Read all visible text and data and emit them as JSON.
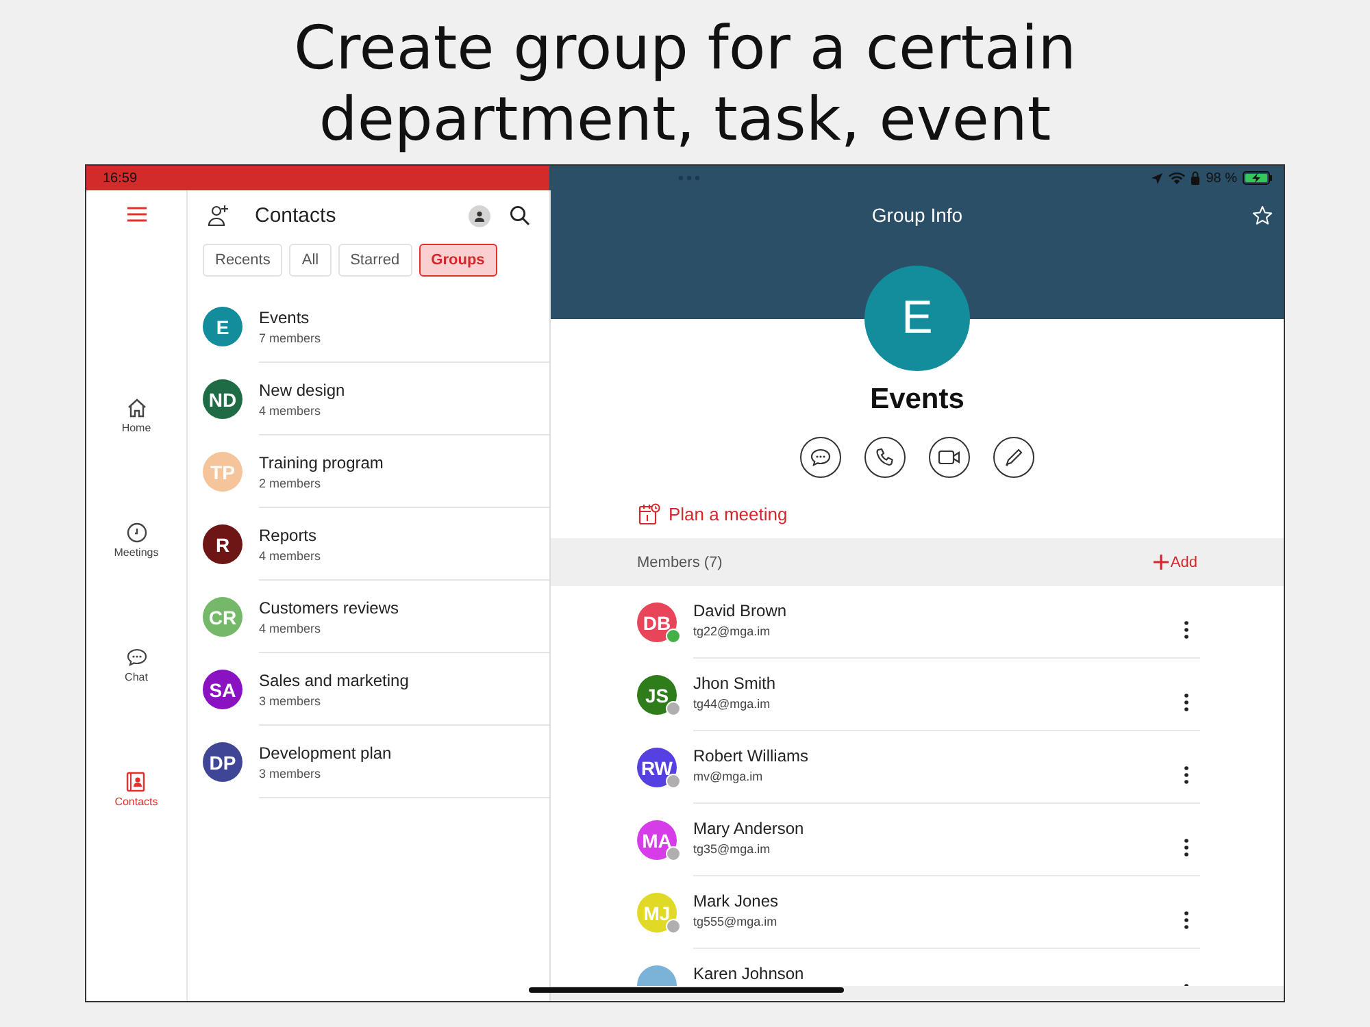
{
  "caption": [
    "Create group for a certain",
    "department, task, event"
  ],
  "status_bar": {
    "time": "16:59",
    "battery": "98 %"
  },
  "sidebar": {
    "items": [
      {
        "label": "Home",
        "kind": "home",
        "selected": false
      },
      {
        "label": "Meetings",
        "kind": "clock",
        "selected": false
      },
      {
        "label": "Chat",
        "kind": "chat",
        "selected": false
      },
      {
        "label": "Contacts",
        "kind": "contacts",
        "selected": true
      }
    ]
  },
  "contacts": {
    "title": "Contacts",
    "filters": [
      {
        "label": "Recents",
        "selected": false
      },
      {
        "label": "All",
        "selected": false
      },
      {
        "label": "Starred",
        "selected": false
      },
      {
        "label": "Groups",
        "selected": true
      }
    ],
    "groups": [
      {
        "initials": "E",
        "name": "Events",
        "subtitle": "7 members",
        "color": "#138d9b"
      },
      {
        "initials": "ND",
        "name": "New design",
        "subtitle": "4 members",
        "color": "#1f6b45"
      },
      {
        "initials": "TP",
        "name": "Training program",
        "subtitle": "2 members",
        "color": "#f5c49a"
      },
      {
        "initials": "R",
        "name": "Reports",
        "subtitle": "4 members",
        "color": "#6e1515"
      },
      {
        "initials": "CR",
        "name": "Customers reviews",
        "subtitle": "4 members",
        "color": "#76b86a"
      },
      {
        "initials": "SA",
        "name": "Sales and marketing",
        "subtitle": "3 members",
        "color": "#8a12c0"
      },
      {
        "initials": "DP",
        "name": "Development plan",
        "subtitle": "3 members",
        "color": "#3f4696"
      }
    ]
  },
  "group_info": {
    "title": "Group Info",
    "avatar": "E",
    "name": "Events",
    "actions": [
      {
        "kind": "chat"
      },
      {
        "kind": "phone"
      },
      {
        "kind": "video"
      },
      {
        "kind": "edit"
      }
    ],
    "plan": "Plan a meeting",
    "members_header": "Members (7)",
    "add": "Add",
    "members": [
      {
        "initials": "DB",
        "name": "David Brown",
        "email": "tg22@mga.im",
        "color": "#e8455a",
        "online": true
      },
      {
        "initials": "JS",
        "name": "Jhon Smith",
        "email": "tg44@mga.im",
        "color": "#2e7d1a",
        "online": false
      },
      {
        "initials": "RW",
        "name": "Robert Williams",
        "email": "mv@mga.im",
        "color": "#5540e0",
        "online": false
      },
      {
        "initials": "MA",
        "name": "Mary Anderson",
        "email": "tg35@mga.im",
        "color": "#d63ce8",
        "online": false
      },
      {
        "initials": "MJ",
        "name": "Mark Jones",
        "email": "tg555@mga.im",
        "color": "#e0d925",
        "online": false
      },
      {
        "name": "Karen Johnson",
        "color": "#7ab3d8"
      }
    ]
  }
}
